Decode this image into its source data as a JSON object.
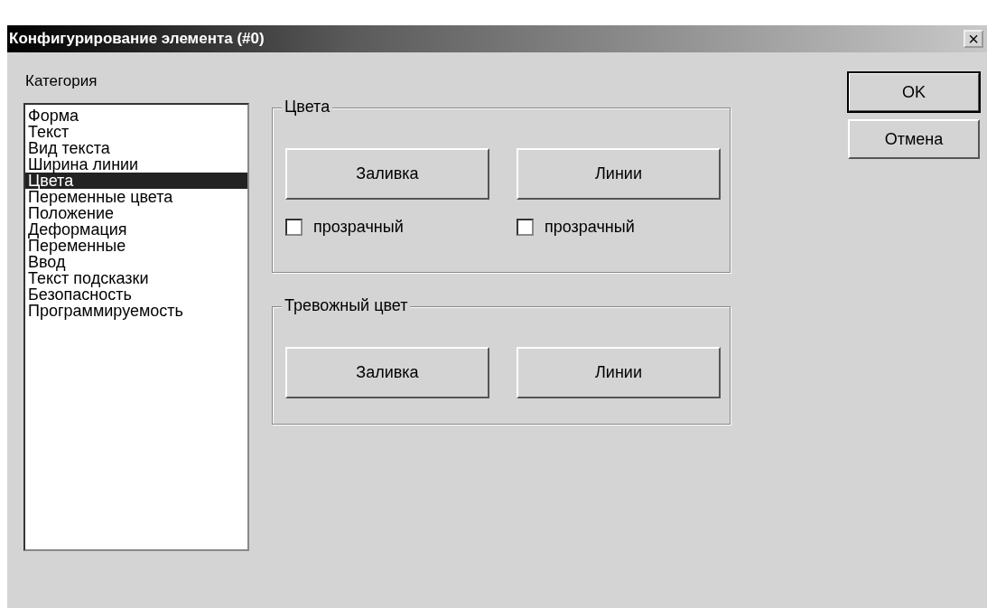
{
  "window": {
    "title": "Конфигурирование элемента (#0)",
    "close": "×"
  },
  "category": {
    "label": "Категория",
    "items": [
      {
        "label": "Форма",
        "selected": false
      },
      {
        "label": "Текст",
        "selected": false
      },
      {
        "label": "Вид текста",
        "selected": false
      },
      {
        "label": "Ширина линии",
        "selected": false
      },
      {
        "label": "Цвета",
        "selected": true
      },
      {
        "label": "Переменные цвета",
        "selected": false
      },
      {
        "label": "Положение",
        "selected": false
      },
      {
        "label": "Деформация",
        "selected": false
      },
      {
        "label": "Переменные",
        "selected": false
      },
      {
        "label": "Ввод",
        "selected": false
      },
      {
        "label": "Текст подсказки",
        "selected": false
      },
      {
        "label": "Безопасность",
        "selected": false
      },
      {
        "label": "Программируемость",
        "selected": false
      }
    ]
  },
  "groups": [
    {
      "title": "Цвета",
      "buttons": [
        "Заливка",
        "Линии"
      ],
      "checkboxes": [
        {
          "label": "прозрачный",
          "checked": false
        },
        {
          "label": "прозрачный",
          "checked": false
        }
      ]
    },
    {
      "title": "Тревожный цвет",
      "buttons": [
        "Заливка",
        "Линии"
      ]
    }
  ],
  "buttons": [
    {
      "label": "OK",
      "default": true
    },
    {
      "label": "Отмена",
      "default": false
    }
  ]
}
